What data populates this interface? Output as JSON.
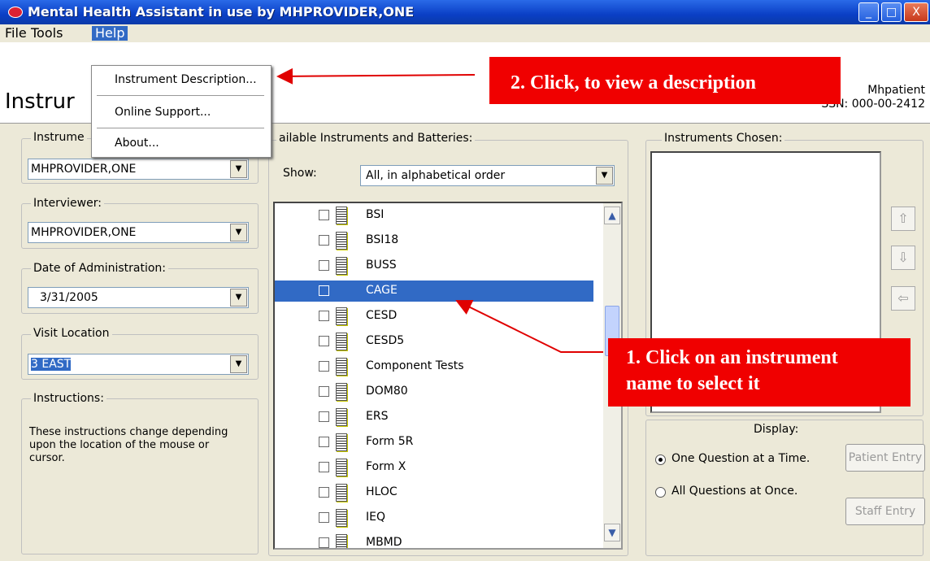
{
  "window": {
    "title": "Mental Health Assistant in use by MHPROVIDER,ONE",
    "buttons": [
      "_",
      "□",
      "X"
    ]
  },
  "menu": [
    "File",
    "Tools",
    "Help"
  ],
  "help_menu": [
    "Instrument Description...",
    "Online Support...",
    "About..."
  ],
  "header": {
    "title": "Instrur",
    "patient_name": "Mhpatient",
    "ssn": "SSN: 000-00-2412"
  },
  "left": {
    "instrument_label": "Instrume",
    "instrument_value": "MHPROVIDER,ONE",
    "interviewer_label": "Interviewer:",
    "interviewer_value": "MHPROVIDER,ONE",
    "date_label": "Date of Administration:",
    "date_value": "3/31/2005",
    "location_label": "Visit Location",
    "location_value": "3 EAST",
    "instructions_label": "Instructions:",
    "instructions_text": "These instructions change depending upon the location of the mouse or cursor."
  },
  "middle": {
    "label": "ailable Instruments and Batteries:",
    "show_label": "Show:",
    "show_value": "All, in alphabetical order",
    "items": [
      "BSI",
      "BSI18",
      "BUSS",
      "CAGE",
      "CESD",
      "CESD5",
      "Component Tests",
      "DOM80",
      "ERS",
      "Form 5R",
      "Form X",
      "HLOC",
      "IEQ",
      "MBMD"
    ],
    "selected": "CAGE"
  },
  "right": {
    "chosen_label": "Instruments Chosen:",
    "display_label": "Display:",
    "radio_one": "One Question at a Time.",
    "radio_all": "All Questions at Once.",
    "patient_entry": "Patient Entry",
    "staff_entry": "Staff Entry"
  },
  "callouts": {
    "view_description": "2. Click, to view a description",
    "select_instrument_1": "1. Click on an instrument",
    "select_instrument_2": "name to select it"
  }
}
